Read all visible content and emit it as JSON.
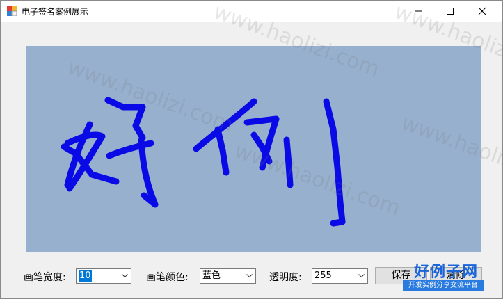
{
  "window": {
    "title": "电子签名案例展示"
  },
  "controls": {
    "pen_width_label": "画笔宽度:",
    "pen_width_value": "10",
    "pen_color_label": "画笔颜色:",
    "pen_color_value": "蓝色",
    "opacity_label": "透明度:",
    "opacity_value": "255",
    "save_label": "保存",
    "clear_label": "清除"
  },
  "canvas": {
    "background": "#97b0cd",
    "stroke_color": "#0a0ae6",
    "handwriting": "好例"
  },
  "watermark": {
    "text": "www.haolizi.com"
  },
  "logo": {
    "title": "好例子网",
    "subtitle": "开发实例分享交流平台"
  }
}
